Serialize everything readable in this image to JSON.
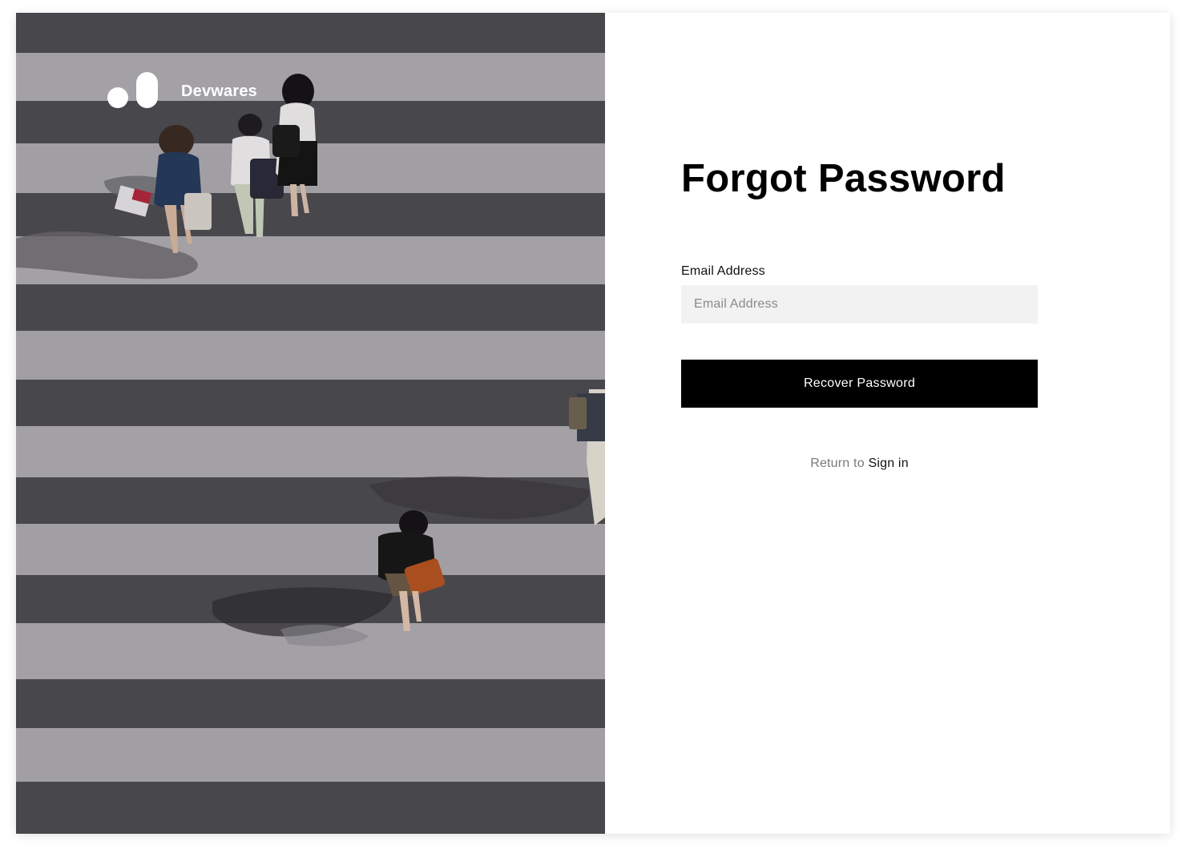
{
  "brand": {
    "name": "Devwares"
  },
  "form": {
    "title": "Forgot Password",
    "email_label": "Email Address",
    "email_placeholder": "Email Address",
    "email_value": "",
    "submit_label": "Recover Password",
    "return_prefix": "Return to",
    "signin_label": "Sign in"
  },
  "icons": {
    "logo": "devwares-logo-icon"
  },
  "colors": {
    "button_bg": "#000000",
    "button_text": "#ffffff",
    "input_bg": "#f2f2f2",
    "muted_text": "#7a7a7a"
  }
}
